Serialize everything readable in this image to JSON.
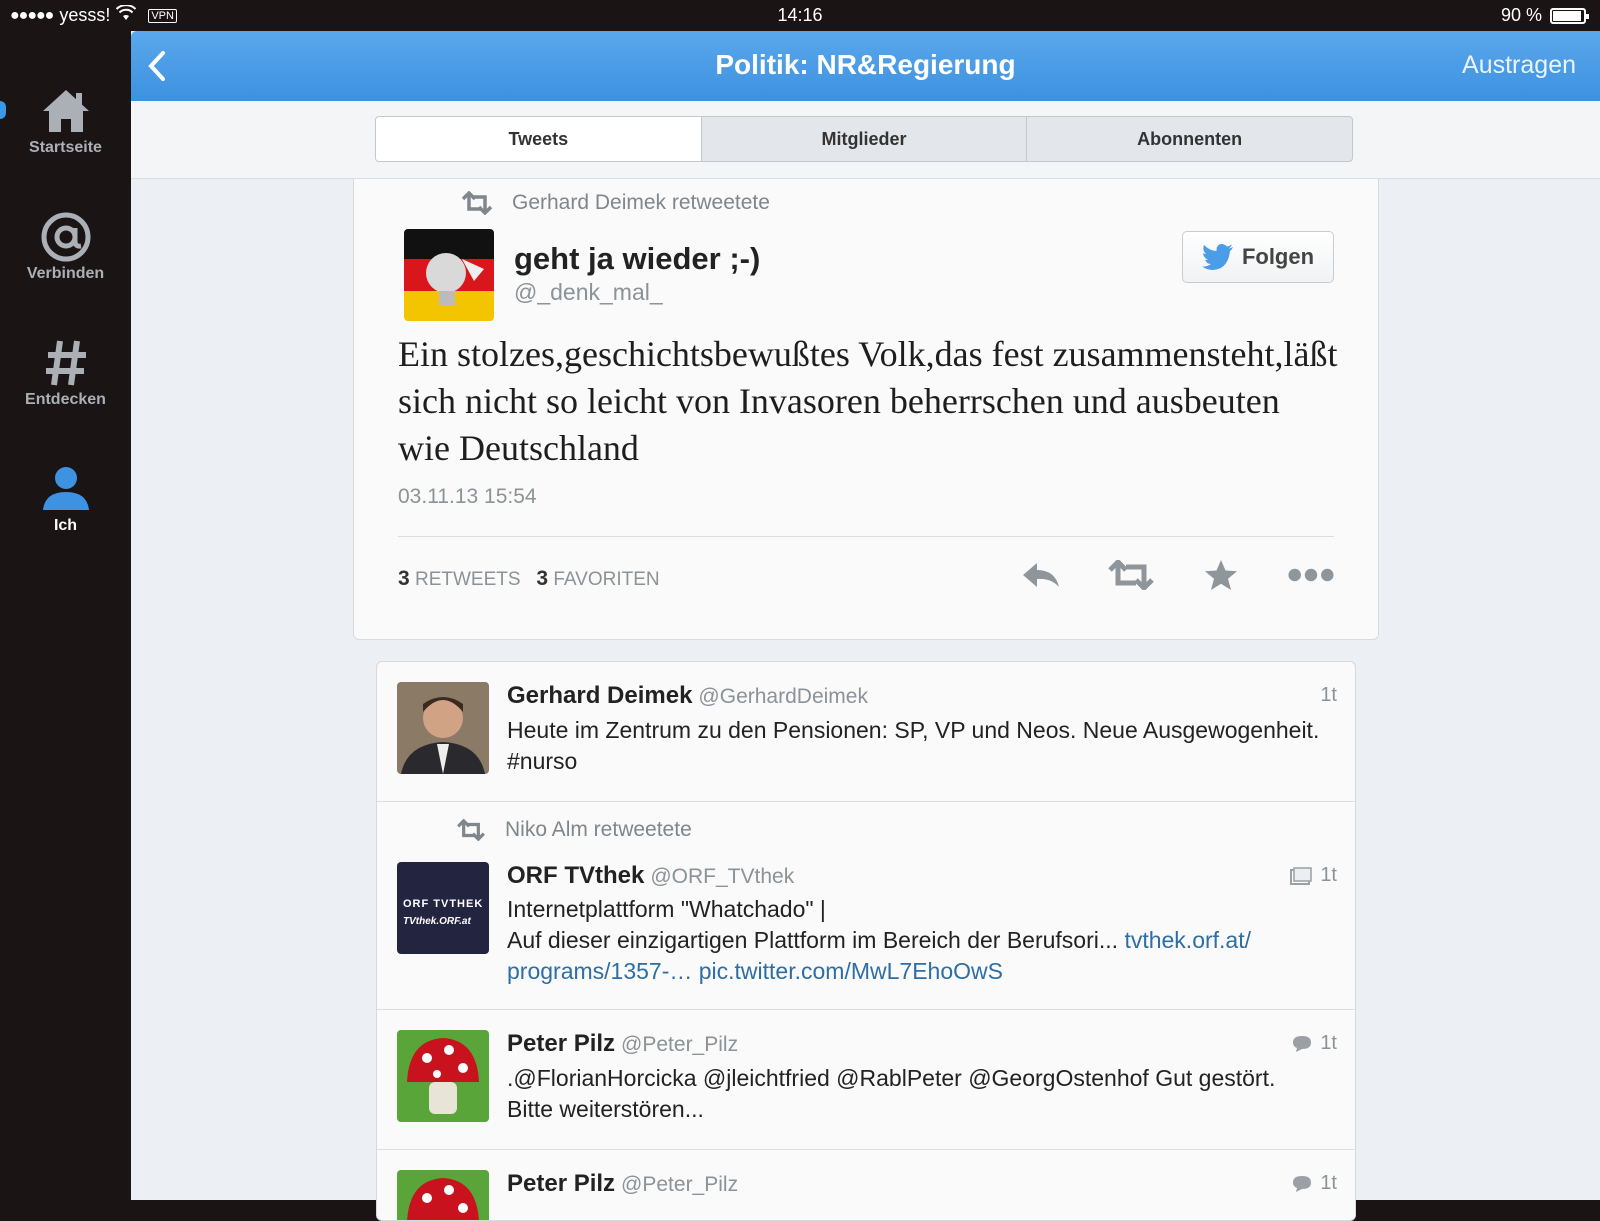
{
  "status_bar": {
    "carrier": "yesss!",
    "vpn": "VPN",
    "time": "14:16",
    "battery": "90 %",
    "battery_level": 0.9
  },
  "sidebar": {
    "items": [
      {
        "label": "Startseite",
        "icon": "home-icon",
        "active": false
      },
      {
        "label": "Verbinden",
        "icon": "at-icon",
        "active": false
      },
      {
        "label": "Entdecken",
        "icon": "hash-icon",
        "active": false
      },
      {
        "label": "Ich",
        "icon": "person-icon",
        "active": true
      }
    ]
  },
  "navbar": {
    "title": "Politik: NR&Regierung",
    "unsubscribe": "Austragen"
  },
  "tabs": [
    {
      "label": "Tweets",
      "active": true
    },
    {
      "label": "Mitglieder",
      "active": false
    },
    {
      "label": "Abonnenten",
      "active": false
    }
  ],
  "detail_tweet": {
    "retweeted_by": "Gerhard Deimek retweetete",
    "name": "geht ja wieder ;-)",
    "handle": "@_denk_mal_",
    "follow_label": "Folgen",
    "text": "Ein stolzes,geschichtsbewußtes Volk,das fest zusammensteht,läßt sich nicht so leicht von Invasoren beherrschen und ausbeuten wie Deutschland",
    "date": "03.11.13 15:54",
    "retweets_count": "3",
    "retweets_label": "RETWEETS",
    "favorites_count": "3",
    "favorites_label": "FAVORITEN"
  },
  "timeline": [
    {
      "name": "Gerhard Deimek",
      "handle": "@GerhardDeimek",
      "time": "1t",
      "text": "Heute im Zentrum zu den Pensionen: SP, VP und Neos. Neue Ausgewogenheit. #nurso"
    },
    {
      "retweeted_by": "Niko Alm retweetete",
      "name": "ORF TVthek",
      "handle": "@ORF_TVthek",
      "time": "1t",
      "text": "Internetplattform \"Whatchado\" |",
      "text2": "Auf dieser einzigartigen Plattform im Bereich der Berufsori...",
      "link1a": "tvthek.orf.at/",
      "link1b": "programs/1357-…",
      "link2": "pic.twitter.com/MwL7EhoOwS",
      "avatar_text": "ORF TVTHEK",
      "avatar_sub": "TVthek.ORF.at"
    },
    {
      "name": "Peter Pilz",
      "handle": "@Peter_Pilz",
      "time": "1t",
      "text": ".@FlorianHorcicka @jleichtfried @RablPeter @GeorgOstenhof Gut gestört. Bitte weiterstören..."
    },
    {
      "name": "Peter Pilz",
      "handle": "@Peter_Pilz",
      "time": "1t"
    }
  ],
  "colors": {
    "accent": "#4a9de6",
    "link": "#2e6ea4"
  }
}
